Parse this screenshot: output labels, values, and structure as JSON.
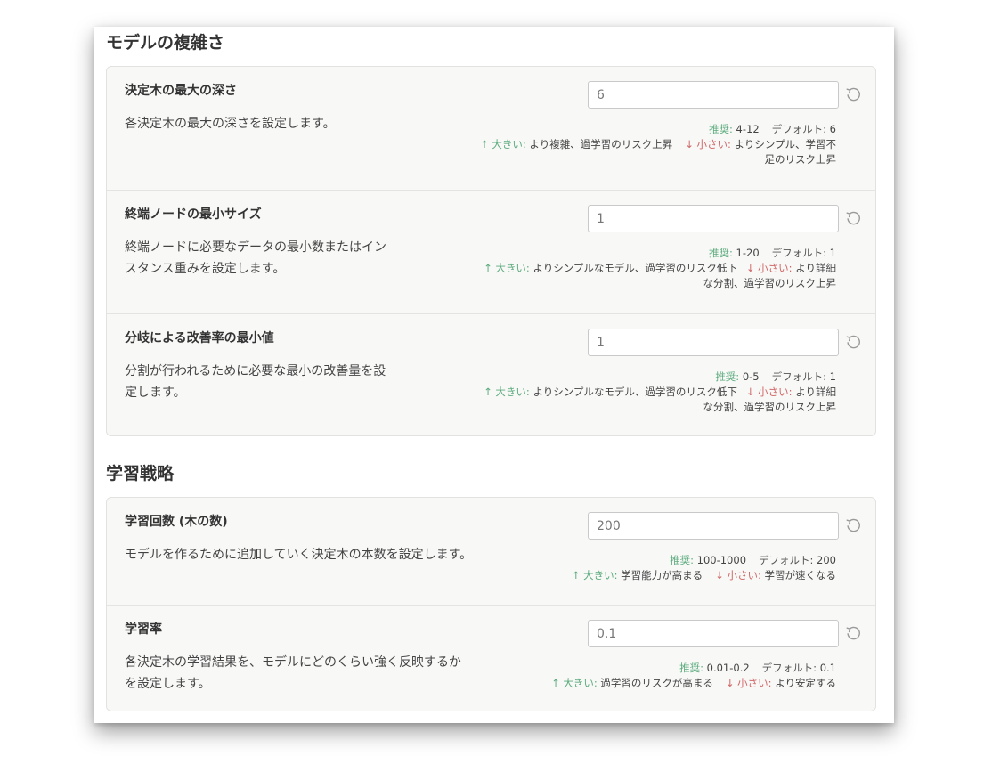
{
  "sections": [
    {
      "title": "モデルの複雑さ",
      "params": [
        {
          "name": "決定木の最大の深さ",
          "desc": "各決定木の最大の深さを設定します。",
          "value": "6",
          "rec_label": "推奨:",
          "rec_value": "4-12",
          "default_label": "デフォルト:",
          "default_value": "6",
          "up_label": "↑ 大きい:",
          "up_text": "より複雑、過学習のリスク上昇",
          "down_label": "↓ 小さい:",
          "down_text": "よりシンプル、学習不",
          "down_text2": "足のリスク上昇"
        },
        {
          "name": "終端ノードの最小サイズ",
          "desc": "終端ノードに必要なデータの最小数またはイン",
          "desc2": "スタンス重みを設定します。",
          "value": "1",
          "rec_label": "推奨:",
          "rec_value": "1-20",
          "default_label": "デフォルト:",
          "default_value": "1",
          "up_label": "↑ 大きい:",
          "up_text": "よりシンプルなモデル、過学習のリスク低下",
          "down_label": "↓ 小さい:",
          "down_text": "より詳細",
          "down_text2": "な分割、過学習のリスク上昇"
        },
        {
          "name": "分岐による改善率の最小値",
          "desc": "分割が行われるために必要な最小の改善量を設",
          "desc2": "定します。",
          "value": "1",
          "rec_label": "推奨:",
          "rec_value": "0-5",
          "default_label": "デフォルト:",
          "default_value": "1",
          "up_label": "↑ 大きい:",
          "up_text": "よりシンプルなモデル、過学習のリスク低下",
          "down_label": "↓ 小さい:",
          "down_text": "より詳細",
          "down_text2": "な分割、過学習のリスク上昇"
        }
      ]
    },
    {
      "title": "学習戦略",
      "params": [
        {
          "name": "学習回数 (木の数)",
          "desc": "モデルを作るために追加していく決定木の本数を設定します。",
          "value": "200",
          "rec_label": "推奨:",
          "rec_value": "100-1000",
          "default_label": "デフォルト:",
          "default_value": "200",
          "up_label": "↑ 大きい:",
          "up_text": "学習能力が高まる",
          "down_label": "↓ 小さい:",
          "down_text": "学習が速くなる"
        },
        {
          "name": "学習率",
          "desc": "各決定木の学習結果を、モデルにどのくらい強く反映するか",
          "desc2": "を設定します。",
          "value": "0.1",
          "rec_label": "推奨:",
          "rec_value": "0.01-0.2",
          "default_label": "デフォルト:",
          "default_value": "0.1",
          "up_label": "↑ 大きい:",
          "up_text": "過学習のリスクが高まる",
          "down_label": "↓ 小さい:",
          "down_text": "より安定する"
        }
      ]
    }
  ],
  "icons": {
    "reset": "reset-icon"
  },
  "colors": {
    "recommend": "#5cab7d",
    "increase": "#5cab7d",
    "decrease": "#d06666",
    "card_bg": "#f8f8f7"
  }
}
